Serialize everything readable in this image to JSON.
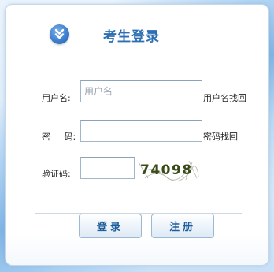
{
  "header": {
    "title": "考生登录",
    "icon": "download-arrow-icon",
    "accent": "#2c6fb2"
  },
  "form": {
    "username_label": "用户名:",
    "username_placeholder": "用户名",
    "username_value": "",
    "find_username_link": "用户名找回",
    "password_label": "密 码:",
    "password_value": "",
    "find_password_link": "密码找回",
    "captcha_label": "验证码:",
    "captcha_value": "",
    "captcha_text": "74098"
  },
  "buttons": {
    "login_label": "登录",
    "register_label": "注册"
  }
}
